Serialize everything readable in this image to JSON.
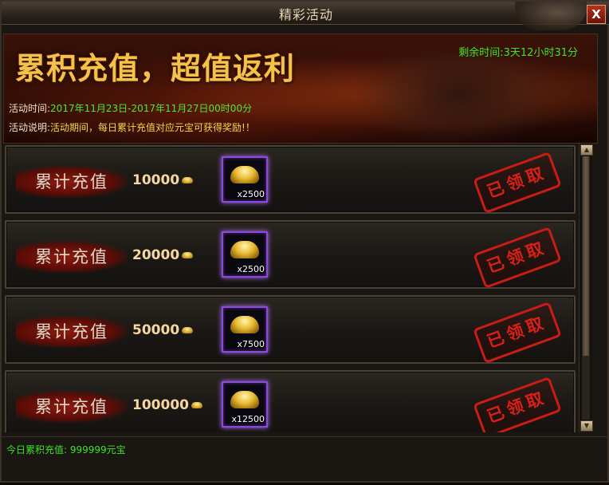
{
  "window": {
    "title": "精彩活动",
    "close_label": "X"
  },
  "banner": {
    "headline": "累积充值，超值返利",
    "remaining_label": "剩余时间:",
    "remaining_value": "3天12小时31分",
    "time_label": "活动时间:",
    "time_value": "2017年11月23日-2017年11月27日00时00分",
    "desc_label": "活动说明:",
    "desc_value": "活动期间，每日累计充值对应元宝可获得奖励!！"
  },
  "rewards": [
    {
      "tag": "累计充值",
      "amount": "10000",
      "reward_qty": "x2500",
      "status": "已领取"
    },
    {
      "tag": "累计充值",
      "amount": "20000",
      "reward_qty": "x2500",
      "status": "已领取"
    },
    {
      "tag": "累计充值",
      "amount": "50000",
      "reward_qty": "x7500",
      "status": "已领取"
    },
    {
      "tag": "累计充值",
      "amount": "100000",
      "reward_qty": "x12500",
      "status": "已领取"
    }
  ],
  "scrollbar": {
    "up_icon": "▲",
    "down_icon": "▼"
  },
  "footer": {
    "today_total": "今日累积充值: 999999元宝"
  },
  "colors": {
    "accent_green": "#3ee22a",
    "accent_yellow": "#f7d64a",
    "stamp_red": "#c81c14",
    "slot_purple": "#8a4cd8"
  }
}
